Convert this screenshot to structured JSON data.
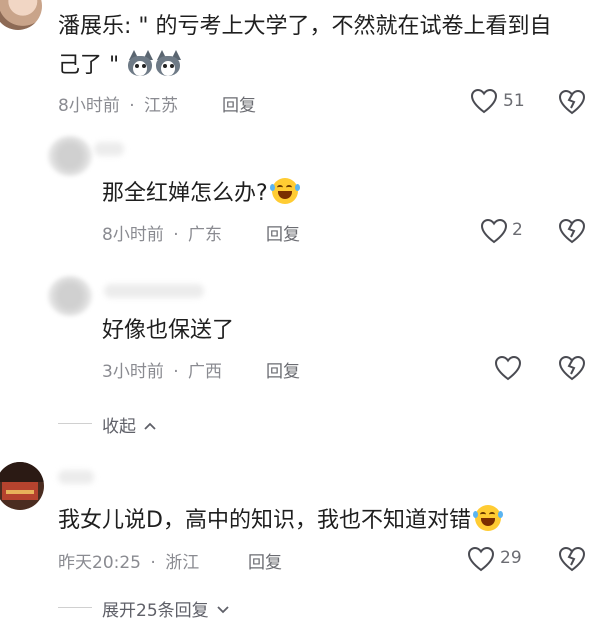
{
  "comments": [
    {
      "author": "潘展乐",
      "text_line1": ": \" 的亏考上大学了，不然就在试卷上看到自",
      "text_line2": "己了 \"",
      "time": "8小时前",
      "location": "江苏",
      "reply_label": "回复",
      "likes": "51",
      "emoji": "husky-icon"
    },
    {
      "text": "那全红婵怎么办?",
      "time": "8小时前",
      "location": "广东",
      "reply_label": "回复",
      "likes": "2",
      "emoji": "laughing-tears-icon"
    },
    {
      "text": "好像也保送了",
      "time": "3小时前",
      "location": "广西",
      "reply_label": "回复",
      "likes": ""
    },
    {
      "text": "我女儿说D，高中的知识，我也不知道对错",
      "time": "昨天20:25",
      "location": "浙江",
      "reply_label": "回复",
      "likes": "29",
      "emoji": "laughing-tears-icon"
    }
  ],
  "collapse_label": "收起",
  "expand_label": "展开25条回复",
  "separator": "·"
}
